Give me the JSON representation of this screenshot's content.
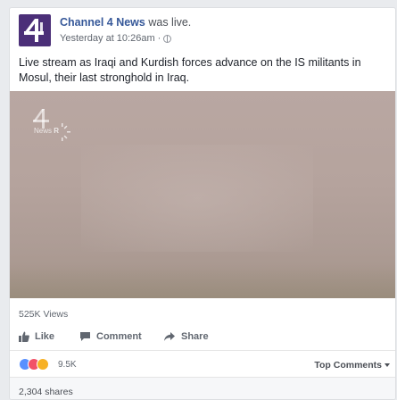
{
  "post": {
    "page_name": "Channel 4 News",
    "status_suffix": " was live.",
    "timestamp": "Yesterday at 10:26am",
    "separator": "·",
    "privacy_icon": "globe-icon",
    "text": "Live stream as Iraqi and Kurdish forces advance on the IS militants in Mosul, their last stronghold in Iraq."
  },
  "video": {
    "watermark_text": "News",
    "watermark_badge": "R"
  },
  "stats": {
    "views": "525K Views",
    "reaction_count": "9.5K",
    "shares": "2,304 shares"
  },
  "actions": {
    "like_label": "Like",
    "comment_label": "Comment",
    "share_label": "Share"
  },
  "comments": {
    "sort_label": "Top Comments"
  },
  "colors": {
    "avatar_bg": "#4b2f78",
    "link": "#365899",
    "like_reaction": "#5890ff",
    "love_reaction": "#f25268",
    "sad_reaction": "#f7b125"
  }
}
